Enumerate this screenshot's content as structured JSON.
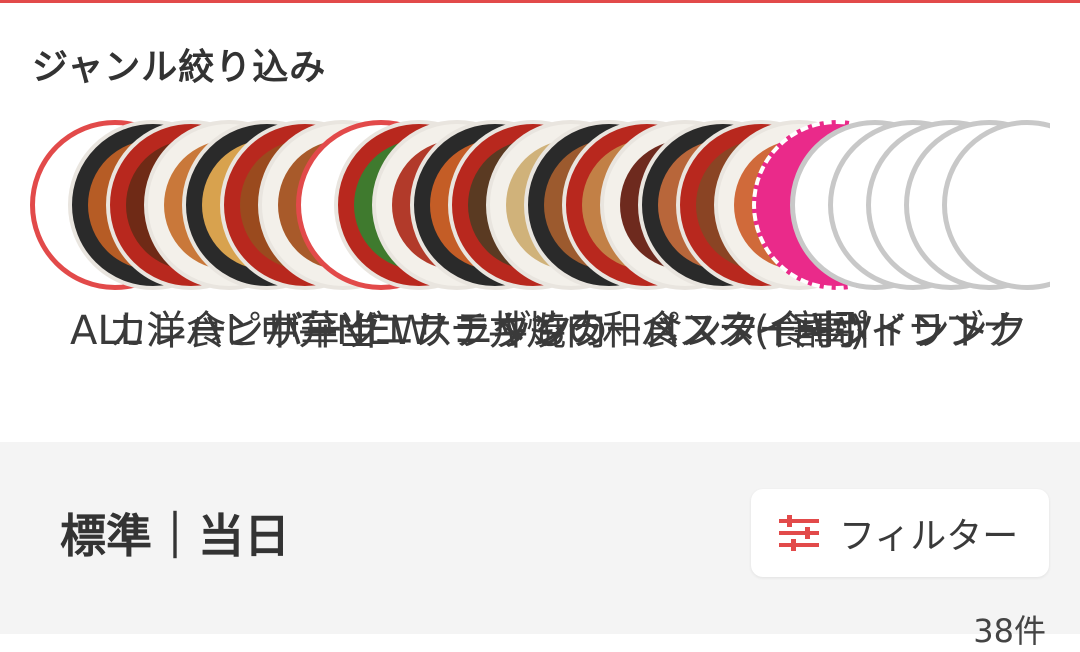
{
  "header": {
    "title": "ジャンル絞り込み"
  },
  "colors": {
    "accent": "#e24a4a",
    "background": "#ffffff",
    "panel": "#f4f4f4",
    "text": "#333333",
    "pink": "#ea2a8a"
  },
  "genres": [
    {
      "label": "ALL",
      "icon": "all-genres-icon",
      "style": "red-ring"
    },
    {
      "label": "カレー",
      "icon": "curry-icon",
      "style": "plate"
    },
    {
      "label": "洋食",
      "icon": "western-food-icon",
      "style": "plate"
    },
    {
      "label": "ハンバーグ",
      "icon": "hamburg-steak-icon",
      "style": "plate"
    },
    {
      "label": "ピザ",
      "icon": "pizza-icon",
      "style": "plate"
    },
    {
      "label": "中華",
      "icon": "chinese-food-icon",
      "style": "plate"
    },
    {
      "label": "弁当",
      "icon": "bento-icon",
      "style": "plate"
    },
    {
      "label": "NEW",
      "icon": "new-icon",
      "style": "red-ring"
    },
    {
      "label": "エスニック",
      "icon": "ethnic-food-icon",
      "style": "plate"
    },
    {
      "label": "サラダ",
      "icon": "salad-icon",
      "style": "plate"
    },
    {
      "label": "チキン",
      "icon": "chicken-icon",
      "style": "plate"
    },
    {
      "label": "丼もの",
      "icon": "rice-bowl-icon",
      "style": "plate"
    },
    {
      "label": "焼肉",
      "icon": "yakiniku-icon",
      "style": "plate"
    },
    {
      "label": "ラーメン",
      "icon": "ramen-icon",
      "style": "plate"
    },
    {
      "label": "和食",
      "icon": "japanese-food-icon",
      "style": "plate"
    },
    {
      "label": "パスタ",
      "icon": "pasta-icon",
      "style": "plate"
    },
    {
      "label": "ステーキ",
      "icon": "steak-icon",
      "style": "plate"
    },
    {
      "label": "スイーツ",
      "icon": "sweets-icon",
      "style": "plate"
    },
    {
      "label": "(食事)",
      "icon": "meal-icon",
      "style": "plate"
    },
    {
      "label": "割引",
      "icon": "discount-icon",
      "style": "pink-badge"
    },
    {
      "label": "ポイント",
      "icon": "points-icon",
      "style": "grey-ring"
    },
    {
      "label": "ドリンク",
      "icon": "drink-icon",
      "style": "grey-ring"
    },
    {
      "label": "ラ",
      "icon": "grey-item-icon",
      "style": "grey-ring"
    },
    {
      "label": "ブ",
      "icon": "grey-item-icon",
      "style": "grey-ring"
    },
    {
      "label": "ナ",
      "icon": "grey-item-icon",
      "style": "grey-ring"
    }
  ],
  "sort": {
    "title": "標準｜当日"
  },
  "filter": {
    "label": "フィルター",
    "icon": "filter-sliders-icon"
  },
  "results": {
    "count": "38件"
  }
}
